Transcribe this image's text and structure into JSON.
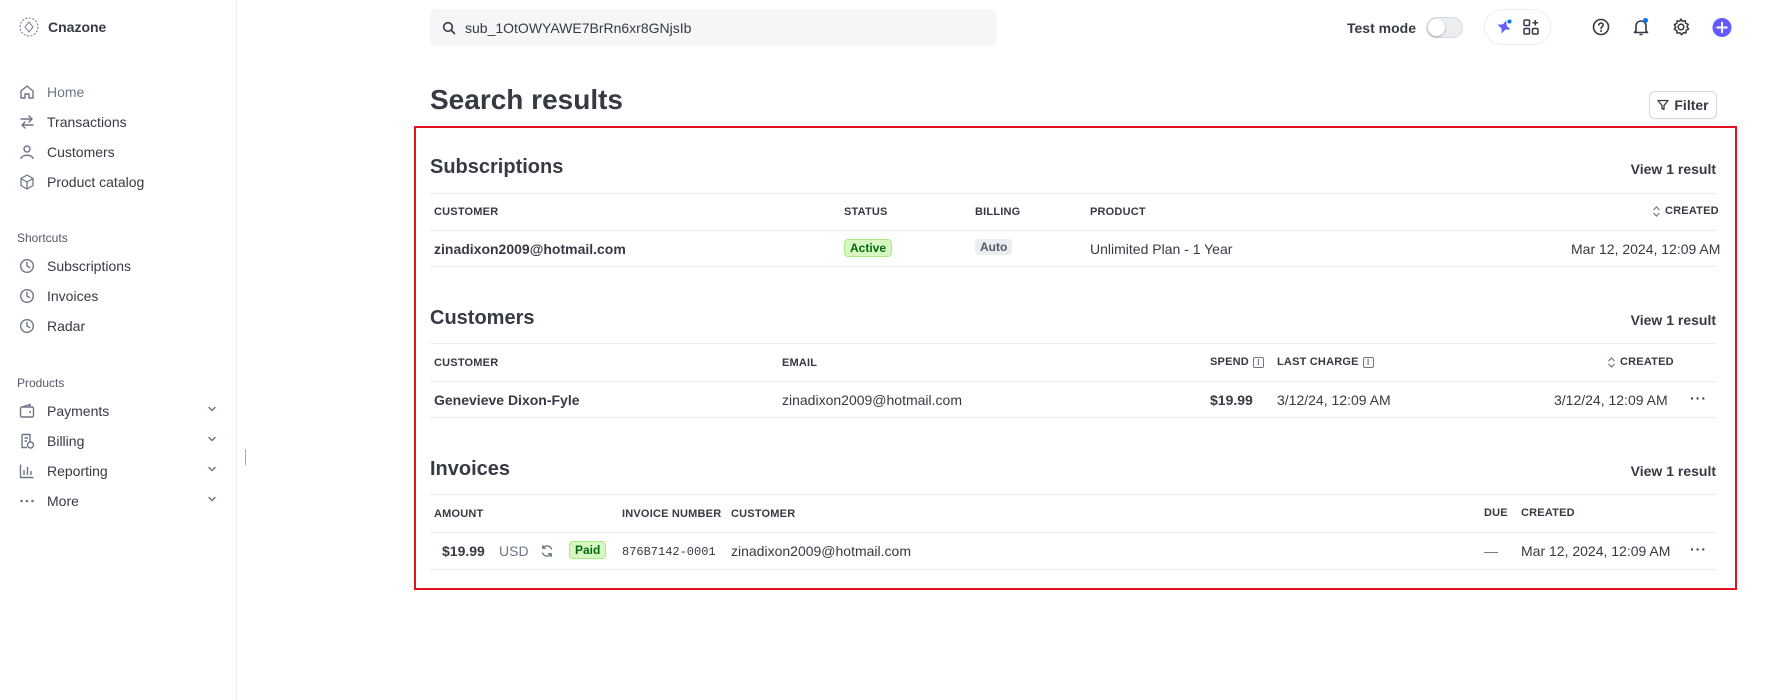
{
  "app": {
    "name": "Cnazone"
  },
  "sidebar": {
    "nav": [
      {
        "label": "Home",
        "icon": "home-icon"
      },
      {
        "label": "Transactions",
        "icon": "transactions-icon"
      },
      {
        "label": "Customers",
        "icon": "person-icon"
      },
      {
        "label": "Product catalog",
        "icon": "box-icon"
      }
    ],
    "shortcuts_label": "Shortcuts",
    "shortcuts": [
      {
        "label": "Subscriptions",
        "icon": "clock-icon"
      },
      {
        "label": "Invoices",
        "icon": "clock-icon"
      },
      {
        "label": "Radar",
        "icon": "clock-icon"
      }
    ],
    "products_label": "Products",
    "products": [
      {
        "label": "Payments",
        "icon": "wallet-icon"
      },
      {
        "label": "Billing",
        "icon": "billing-icon"
      },
      {
        "label": "Reporting",
        "icon": "bar-chart-icon"
      },
      {
        "label": "More",
        "icon": "more-dots-icon"
      }
    ]
  },
  "topbar": {
    "search_value": "sub_1OtOWYAWE7BrRn6xr8GNjsIb",
    "test_mode_label": "Test mode",
    "test_mode_on": false
  },
  "page": {
    "title": "Search results",
    "filter_label": "Filter"
  },
  "subscriptions": {
    "title": "Subscriptions",
    "view_label": "View 1 result",
    "columns": [
      "CUSTOMER",
      "STATUS",
      "BILLING",
      "PRODUCT",
      "CREATED"
    ],
    "row": {
      "customer": "zinadixon2009@hotmail.com",
      "status": "Active",
      "billing": "Auto",
      "product": "Unlimited Plan - 1 Year",
      "created": "Mar 12, 2024, 12:09 AM"
    }
  },
  "customers": {
    "title": "Customers",
    "view_label": "View 1 result",
    "columns": [
      "CUSTOMER",
      "EMAIL",
      "SPEND",
      "LAST CHARGE",
      "CREATED"
    ],
    "row": {
      "customer": "Genevieve Dixon-Fyle",
      "email": "zinadixon2009@hotmail.com",
      "spend": "$19.99",
      "last_charge": "3/12/24, 12:09 AM",
      "created": "3/12/24, 12:09 AM"
    }
  },
  "invoices": {
    "title": "Invoices",
    "view_label": "View 1 result",
    "columns": [
      "AMOUNT",
      "INVOICE NUMBER",
      "CUSTOMER",
      "DUE",
      "CREATED"
    ],
    "row": {
      "amount": "$19.99",
      "currency": "USD",
      "status": "Paid",
      "number": "876B7142-0001",
      "customer": "zinadixon2009@hotmail.com",
      "due": "—",
      "created": "Mar 12, 2024, 12:09 AM"
    }
  },
  "colors": {
    "highlight": "#e0141e",
    "accent": "#635bff",
    "success_bg": "#d7f7c2",
    "success_text": "#05690d"
  }
}
